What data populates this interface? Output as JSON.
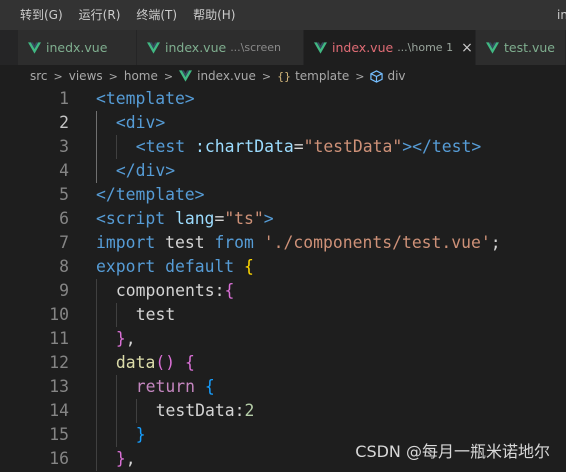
{
  "menu": {
    "items": [
      "转到(G)",
      "运行(R)",
      "终端(T)",
      "帮助(H)"
    ],
    "clipped_title": "in"
  },
  "tabs": [
    {
      "name": "inedx.vue",
      "path": "",
      "active": false
    },
    {
      "name": "index.vue",
      "path": "...\\screen",
      "active": false
    },
    {
      "name": "index.vue",
      "path": "...\\home 1",
      "active": true
    },
    {
      "name": "test.vue",
      "path": "",
      "active": false
    }
  ],
  "tab_close_glyph": "×",
  "breadcrumb": {
    "items": [
      "src",
      "views",
      "home",
      "index.vue",
      "template",
      "div"
    ],
    "separator": ">"
  },
  "editor": {
    "current_line": 2,
    "lines": [
      {
        "n": "1",
        "tokens": [
          [
            "tag",
            "<template>"
          ]
        ]
      },
      {
        "n": "2",
        "tokens": [
          [
            "tag",
            "<div>"
          ]
        ]
      },
      {
        "n": "3",
        "tokens": [
          [
            "tag",
            "<test"
          ],
          [
            "text",
            " "
          ],
          [
            "attr",
            ":chartData"
          ],
          [
            "text",
            "="
          ],
          [
            "str",
            "\"testData\""
          ],
          [
            "tag",
            "></test>"
          ]
        ]
      },
      {
        "n": "4",
        "tokens": [
          [
            "tag",
            "</div>"
          ]
        ]
      },
      {
        "n": "5",
        "tokens": [
          [
            "tag",
            "</template>"
          ]
        ]
      },
      {
        "n": "6",
        "tokens": [
          [
            "tag",
            "<script"
          ],
          [
            "text",
            " "
          ],
          [
            "attr",
            "lang"
          ],
          [
            "text",
            "="
          ],
          [
            "str",
            "\"ts\""
          ],
          [
            "tag",
            ">"
          ]
        ]
      },
      {
        "n": "7",
        "tokens": [
          [
            "kw",
            "import"
          ],
          [
            "text",
            " test "
          ],
          [
            "kw",
            "from"
          ],
          [
            "text",
            " "
          ],
          [
            "str",
            "'./components/test.vue'"
          ],
          [
            "text",
            ";"
          ]
        ]
      },
      {
        "n": "8",
        "tokens": [
          [
            "kw",
            "export"
          ],
          [
            "text",
            " "
          ],
          [
            "kw",
            "default"
          ],
          [
            "text",
            " "
          ],
          [
            "b1",
            "{"
          ]
        ]
      },
      {
        "n": "9",
        "tokens": [
          [
            "text",
            "components:"
          ],
          [
            "b2",
            "{"
          ]
        ]
      },
      {
        "n": "10",
        "tokens": [
          [
            "text",
            "test"
          ]
        ]
      },
      {
        "n": "11",
        "tokens": [
          [
            "b2",
            "}"
          ],
          [
            "text",
            ","
          ]
        ]
      },
      {
        "n": "12",
        "tokens": [
          [
            "fn",
            "data"
          ],
          [
            "b2",
            "()"
          ],
          [
            "text",
            " "
          ],
          [
            "b2",
            "{"
          ]
        ]
      },
      {
        "n": "13",
        "tokens": [
          [
            "kwc",
            "return"
          ],
          [
            "text",
            " "
          ],
          [
            "b3",
            "{"
          ]
        ]
      },
      {
        "n": "14",
        "tokens": [
          [
            "text",
            "testData:"
          ],
          [
            "num",
            "2"
          ]
        ]
      },
      {
        "n": "15",
        "tokens": [
          [
            "b3",
            "}"
          ]
        ]
      },
      {
        "n": "16",
        "tokens": [
          [
            "b2",
            "}"
          ],
          [
            "text",
            ","
          ]
        ]
      }
    ]
  },
  "watermark": "CSDN @每月一瓶米诺地尔",
  "colors": {
    "background": "#1e1e1e",
    "tag": "#569cd6",
    "attribute": "#9cdcfe",
    "string": "#ce9178",
    "vue_icon": "#41b883"
  }
}
